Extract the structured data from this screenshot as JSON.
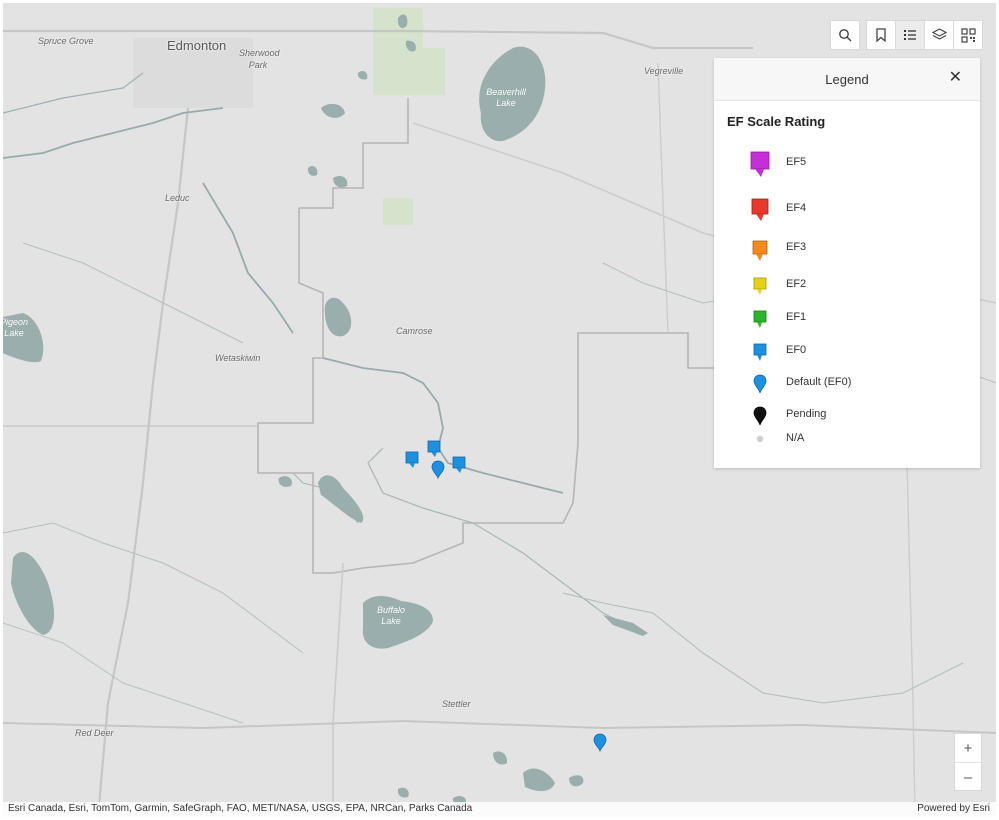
{
  "map": {
    "places": [
      {
        "name": "Spruce Grove"
      },
      {
        "name": "Edmonton"
      },
      {
        "name": "Sherwood Park"
      },
      {
        "name": "Vegreville"
      },
      {
        "name": "Beaverhill Lake"
      },
      {
        "name": "Leduc"
      },
      {
        "name": "Camrose"
      },
      {
        "name": "Wetaskiwin"
      },
      {
        "name": "Pigeon Lake"
      },
      {
        "name": "Buffalo Lake"
      },
      {
        "name": "Stettler"
      },
      {
        "name": "Red Deer"
      }
    ],
    "markers": [
      {
        "rating": "EF0",
        "shape": "square"
      },
      {
        "rating": "EF0",
        "shape": "square"
      },
      {
        "rating": "Default (EF0)",
        "shape": "round"
      },
      {
        "rating": "EF0",
        "shape": "square"
      },
      {
        "rating": "Default (EF0)",
        "shape": "round"
      }
    ]
  },
  "toolbar": {
    "search_icon": "search-icon",
    "bookmark_icon": "bookmark-icon",
    "legend_icon": "legend-list-icon",
    "layers_icon": "layers-icon",
    "qr_icon": "qr-code-icon"
  },
  "legend": {
    "title": "Legend",
    "close_label": "✕",
    "section_title": "EF Scale Rating",
    "items": [
      {
        "label": "EF5",
        "color": "#c42fd6",
        "shape": "square"
      },
      {
        "label": "EF4",
        "color": "#e8372b",
        "shape": "square"
      },
      {
        "label": "EF3",
        "color": "#f28a1c",
        "shape": "square"
      },
      {
        "label": "EF2",
        "color": "#e8d11a",
        "shape": "square"
      },
      {
        "label": "EF1",
        "color": "#2bb52b",
        "shape": "square"
      },
      {
        "label": "EF0",
        "color": "#1e90e0",
        "shape": "square"
      },
      {
        "label": "Default (EF0)",
        "color": "#1e90e0",
        "shape": "round"
      },
      {
        "label": "Pending",
        "color": "#111111",
        "shape": "round"
      },
      {
        "label": "N/A",
        "color": "#cfcfcf",
        "shape": "dot"
      }
    ]
  },
  "zoom": {
    "in_label": "+",
    "out_label": "–"
  },
  "attribution": {
    "text": "Esri Canada, Esri, TomTom, Garmin, SafeGraph, FAO, METI/NASA, USGS, EPA, NRCan, Parks Canada",
    "powered_by": "Powered by Esri"
  },
  "colors": {
    "water": "#9aaeae",
    "park": "#d7e3cf",
    "land": "#e3e3e3",
    "roads": "#c9c9c9",
    "rivers": "#8fa3a3"
  }
}
